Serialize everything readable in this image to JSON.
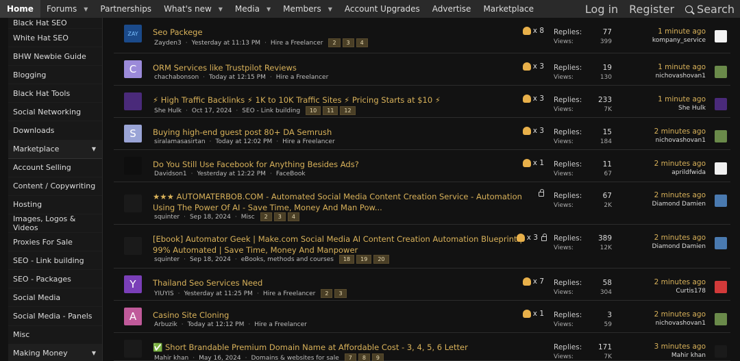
{
  "nav": {
    "items": [
      {
        "label": "Home",
        "caret": false
      },
      {
        "label": "Forums",
        "caret": true
      },
      {
        "label": "Partnerships",
        "caret": false
      },
      {
        "label": "What's new",
        "caret": true
      },
      {
        "label": "Media",
        "caret": true
      },
      {
        "label": "Members",
        "caret": true
      },
      {
        "label": "Account Upgrades",
        "caret": false
      },
      {
        "label": "Advertise",
        "caret": false
      },
      {
        "label": "Marketplace",
        "caret": false
      }
    ],
    "login": "Log in",
    "register": "Register",
    "search": "Search"
  },
  "sidebar": [
    {
      "label": "Black Hat SEO",
      "section": false
    },
    {
      "label": "White Hat SEO",
      "section": false
    },
    {
      "label": "BHW Newbie Guide",
      "section": false
    },
    {
      "label": "Blogging",
      "section": false
    },
    {
      "label": "Black Hat Tools",
      "section": false
    },
    {
      "label": "Social Networking",
      "section": false
    },
    {
      "label": "Downloads",
      "section": false
    },
    {
      "label": "Marketplace",
      "section": true
    },
    {
      "label": "Account Selling",
      "section": false
    },
    {
      "label": "Content / Copywriting",
      "section": false
    },
    {
      "label": "Hosting",
      "section": false
    },
    {
      "label": "Images, Logos & Videos",
      "section": false
    },
    {
      "label": "Proxies For Sale",
      "section": false
    },
    {
      "label": "SEO - Link building",
      "section": false
    },
    {
      "label": "SEO - Packages",
      "section": false
    },
    {
      "label": "Social Media",
      "section": false
    },
    {
      "label": "Social Media - Panels",
      "section": false
    },
    {
      "label": "Misc",
      "section": false
    },
    {
      "label": "Making Money",
      "section": true
    }
  ],
  "threads": [
    {
      "avatar": "ZAY",
      "avatar_color": "#1b4a8a",
      "title": "Seo Packege",
      "author": "Zayden3",
      "date": "Yesterday at 11:13 PM",
      "forum": "Hire a Freelancer",
      "pages": [
        "2",
        "3",
        "4"
      ],
      "reactions": "x 8",
      "locked": false,
      "replies": "77",
      "views": "399",
      "last_time": "1 minute ago",
      "last_user": "kompany_service",
      "last_color": "#f2f2f2"
    },
    {
      "avatar": "C",
      "avatar_color": "#9b8ad9",
      "title": "ORM Services like Trustpilot Reviews",
      "author": "chachabonson",
      "date": "Today at 12:15 PM",
      "forum": "Hire a Freelancer",
      "pages": [],
      "reactions": "x 3",
      "locked": false,
      "replies": "19",
      "views": "130",
      "last_time": "1 minute ago",
      "last_user": "nichovashovan1",
      "last_color": "#6a8a4a"
    },
    {
      "avatar": "",
      "avatar_color": "#4a2a7a",
      "title": "⚡ High Traffic Backlinks ⚡ 1K to 10K Traffic Sites ⚡ Pricing Starts at $10 ⚡",
      "author": "She Hulk",
      "date": "Oct 17, 2024",
      "forum": "SEO - Link building",
      "pages": [
        "10",
        "11",
        "12"
      ],
      "reactions": "x 3",
      "locked": false,
      "replies": "233",
      "views": "7K",
      "last_time": "1 minute ago",
      "last_user": "She Hulk",
      "last_color": "#4a2a7a"
    },
    {
      "avatar": "S",
      "avatar_color": "#9aa4d6",
      "title": "Buying high-end guest post 80+ DA Semrush",
      "author": "siralamasasirtan",
      "date": "Today at 12:02 PM",
      "forum": "Hire a Freelancer",
      "pages": [],
      "reactions": "x 3",
      "locked": false,
      "replies": "15",
      "views": "184",
      "last_time": "2 minutes ago",
      "last_user": "nichovashovan1",
      "last_color": "#6a8a4a"
    },
    {
      "avatar": "",
      "avatar_color": "#0e0e0e",
      "title": "Do You Still Use Facebook for Anything Besides Ads?",
      "author": "Davidson1",
      "date": "Yesterday at 12:22 PM",
      "forum": "FaceBook",
      "pages": [],
      "reactions": "x 1",
      "locked": false,
      "replies": "11",
      "views": "67",
      "last_time": "2 minutes ago",
      "last_user": "aprildfwida",
      "last_color": "#f0f0f0"
    },
    {
      "avatar": "",
      "avatar_color": "#1a1a1a",
      "title": "★★★ AUTOMATERBOB.COM - Automated Social Media Content Creation Service - Automation Using The Power Of AI - Save Time, Money And Man Pow...",
      "author": "squinter",
      "date": "Sep 18, 2024",
      "forum": "Misc",
      "pages": [
        "2",
        "3",
        "4"
      ],
      "reactions": "",
      "locked": true,
      "replies": "67",
      "views": "2K",
      "last_time": "2 minutes ago",
      "last_user": "Diamond Damien",
      "last_color": "#4a7ab0"
    },
    {
      "avatar": "",
      "avatar_color": "#1a1a1a",
      "title": "[Ebook] Automator Geek | Make.com Social Media AI Content Creation Automation Blueprint | 99% Automated | Save Time, Money And Manpower",
      "author": "squinter",
      "date": "Sep 18, 2024",
      "forum": "eBooks, methods and courses",
      "pages": [
        "18",
        "19",
        "20"
      ],
      "reactions": "x 3",
      "locked": true,
      "replies": "389",
      "views": "12K",
      "last_time": "2 minutes ago",
      "last_user": "Diamond Damien",
      "last_color": "#4a7ab0"
    },
    {
      "avatar": "Y",
      "avatar_color": "#7a3fb8",
      "title": "Thailand Seo Services Need",
      "author": "YIUYIS",
      "date": "Yesterday at 11:25 PM",
      "forum": "Hire a Freelancer",
      "pages": [
        "2",
        "3"
      ],
      "reactions": "x 7",
      "locked": false,
      "replies": "58",
      "views": "304",
      "last_time": "2 minutes ago",
      "last_user": "Curtis178",
      "last_color": "#d23a3a"
    },
    {
      "avatar": "A",
      "avatar_color": "#c05a9a",
      "title": "Casino Site Cloning",
      "author": "Arbuzik",
      "date": "Today at 12:12 PM",
      "forum": "Hire a Freelancer",
      "pages": [],
      "reactions": "x 1",
      "locked": false,
      "replies": "3",
      "views": "59",
      "last_time": "2 minutes ago",
      "last_user": "nichovashovan1",
      "last_color": "#6a8a4a"
    },
    {
      "avatar": "",
      "avatar_color": "#1a1a1a",
      "title": "✅ Short Brandable Premium Domain Name at Affordable Cost - 3, 4, 5, 6 Letter",
      "author": "Mahir khan",
      "date": "May 16, 2024",
      "forum": "Domains & websites for sale",
      "pages": [
        "7",
        "8",
        "9"
      ],
      "reactions": "",
      "locked": false,
      "replies": "171",
      "views": "7K",
      "last_time": "3 minutes ago",
      "last_user": "Mahir khan",
      "last_color": "#1a1a1a"
    }
  ],
  "labels": {
    "replies": "Replies:",
    "views": "Views:"
  }
}
